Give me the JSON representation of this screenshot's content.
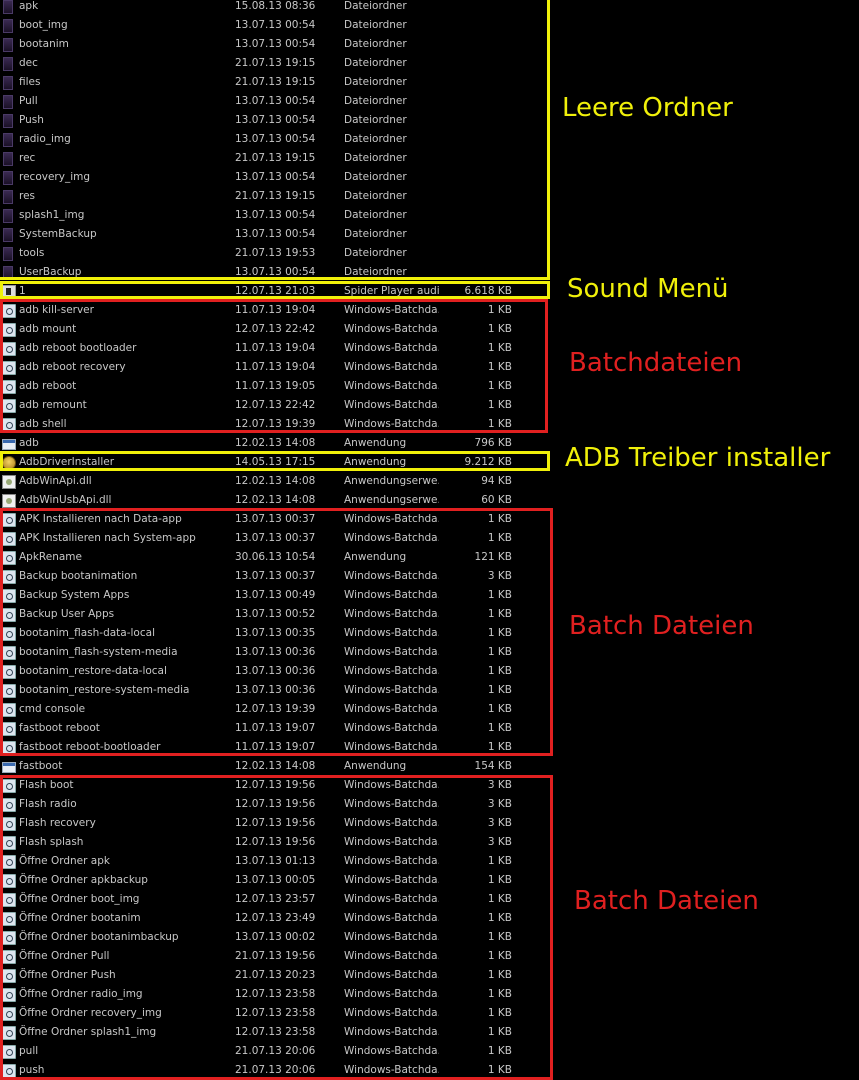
{
  "files": [
    {
      "name": "apk",
      "date": "15.08.13 08:36",
      "type": "Dateiordner",
      "size": "",
      "icon": "folder-icon"
    },
    {
      "name": "boot_img",
      "date": "13.07.13 00:54",
      "type": "Dateiordner",
      "size": "",
      "icon": "folder-icon"
    },
    {
      "name": "bootanim",
      "date": "13.07.13 00:54",
      "type": "Dateiordner",
      "size": "",
      "icon": "folder-icon"
    },
    {
      "name": "dec",
      "date": "21.07.13 19:15",
      "type": "Dateiordner",
      "size": "",
      "icon": "folder-icon"
    },
    {
      "name": "files",
      "date": "21.07.13 19:15",
      "type": "Dateiordner",
      "size": "",
      "icon": "folder-icon"
    },
    {
      "name": "Pull",
      "date": "13.07.13 00:54",
      "type": "Dateiordner",
      "size": "",
      "icon": "folder-icon"
    },
    {
      "name": "Push",
      "date": "13.07.13 00:54",
      "type": "Dateiordner",
      "size": "",
      "icon": "folder-icon"
    },
    {
      "name": "radio_img",
      "date": "13.07.13 00:54",
      "type": "Dateiordner",
      "size": "",
      "icon": "folder-icon"
    },
    {
      "name": "rec",
      "date": "21.07.13 19:15",
      "type": "Dateiordner",
      "size": "",
      "icon": "folder-icon"
    },
    {
      "name": "recovery_img",
      "date": "13.07.13 00:54",
      "type": "Dateiordner",
      "size": "",
      "icon": "folder-icon"
    },
    {
      "name": "res",
      "date": "21.07.13 19:15",
      "type": "Dateiordner",
      "size": "",
      "icon": "folder-icon"
    },
    {
      "name": "splash1_img",
      "date": "13.07.13 00:54",
      "type": "Dateiordner",
      "size": "",
      "icon": "folder-icon"
    },
    {
      "name": "SystemBackup",
      "date": "13.07.13 00:54",
      "type": "Dateiordner",
      "size": "",
      "icon": "folder-icon"
    },
    {
      "name": "tools",
      "date": "21.07.13 19:53",
      "type": "Dateiordner",
      "size": "",
      "icon": "folder-icon"
    },
    {
      "name": "UserBackup",
      "date": "13.07.13 00:54",
      "type": "Dateiordner",
      "size": "",
      "icon": "folder-icon"
    },
    {
      "name": "1",
      "date": "12.07.13 21:03",
      "type": "Spider Player audi...",
      "size": "6.618 KB",
      "icon": "audio-file-icon"
    },
    {
      "name": "adb kill-server",
      "date": "11.07.13 19:04",
      "type": "Windows-Batchda...",
      "size": "1 KB",
      "icon": "batch-file-icon"
    },
    {
      "name": "adb mount",
      "date": "12.07.13 22:42",
      "type": "Windows-Batchda...",
      "size": "1 KB",
      "icon": "batch-file-icon"
    },
    {
      "name": "adb reboot bootloader",
      "date": "11.07.13 19:04",
      "type": "Windows-Batchda...",
      "size": "1 KB",
      "icon": "batch-file-icon"
    },
    {
      "name": "adb reboot recovery",
      "date": "11.07.13 19:04",
      "type": "Windows-Batchda...",
      "size": "1 KB",
      "icon": "batch-file-icon"
    },
    {
      "name": "adb reboot",
      "date": "11.07.13 19:05",
      "type": "Windows-Batchda...",
      "size": "1 KB",
      "icon": "batch-file-icon"
    },
    {
      "name": "adb remount",
      "date": "12.07.13 22:42",
      "type": "Windows-Batchda...",
      "size": "1 KB",
      "icon": "batch-file-icon"
    },
    {
      "name": "adb shell",
      "date": "12.07.13 19:39",
      "type": "Windows-Batchda...",
      "size": "1 KB",
      "icon": "batch-file-icon"
    },
    {
      "name": "adb",
      "date": "12.02.13 14:08",
      "type": "Anwendung",
      "size": "796 KB",
      "icon": "application-icon"
    },
    {
      "name": "AdbDriverInstaller",
      "date": "14.05.13 17:15",
      "type": "Anwendung",
      "size": "9.212 KB",
      "icon": "installer-icon"
    },
    {
      "name": "AdbWinApi.dll",
      "date": "12.02.13 14:08",
      "type": "Anwendungserwe...",
      "size": "94 KB",
      "icon": "dll-file-icon"
    },
    {
      "name": "AdbWinUsbApi.dll",
      "date": "12.02.13 14:08",
      "type": "Anwendungserwe...",
      "size": "60 KB",
      "icon": "dll-file-icon"
    },
    {
      "name": "APK Installieren nach Data-app",
      "date": "13.07.13 00:37",
      "type": "Windows-Batchda...",
      "size": "1 KB",
      "icon": "batch-file-icon"
    },
    {
      "name": "APK Installieren nach System-app",
      "date": "13.07.13 00:37",
      "type": "Windows-Batchda...",
      "size": "1 KB",
      "icon": "batch-file-icon"
    },
    {
      "name": "ApkRename",
      "date": "30.06.13 10:54",
      "type": "Anwendung",
      "size": "121 KB",
      "icon": "batch-file-icon"
    },
    {
      "name": "Backup bootanimation",
      "date": "13.07.13 00:37",
      "type": "Windows-Batchda...",
      "size": "3 KB",
      "icon": "batch-file-icon"
    },
    {
      "name": "Backup System Apps",
      "date": "13.07.13 00:49",
      "type": "Windows-Batchda...",
      "size": "1 KB",
      "icon": "batch-file-icon"
    },
    {
      "name": "Backup User Apps",
      "date": "13.07.13 00:52",
      "type": "Windows-Batchda...",
      "size": "1 KB",
      "icon": "batch-file-icon"
    },
    {
      "name": "bootanim_flash-data-local",
      "date": "13.07.13 00:35",
      "type": "Windows-Batchda...",
      "size": "1 KB",
      "icon": "batch-file-icon"
    },
    {
      "name": "bootanim_flash-system-media",
      "date": "13.07.13 00:36",
      "type": "Windows-Batchda...",
      "size": "1 KB",
      "icon": "batch-file-icon"
    },
    {
      "name": "bootanim_restore-data-local",
      "date": "13.07.13 00:36",
      "type": "Windows-Batchda...",
      "size": "1 KB",
      "icon": "batch-file-icon"
    },
    {
      "name": "bootanim_restore-system-media",
      "date": "13.07.13 00:36",
      "type": "Windows-Batchda...",
      "size": "1 KB",
      "icon": "batch-file-icon"
    },
    {
      "name": "cmd console",
      "date": "12.07.13 19:39",
      "type": "Windows-Batchda...",
      "size": "1 KB",
      "icon": "batch-file-icon"
    },
    {
      "name": "fastboot reboot",
      "date": "11.07.13 19:07",
      "type": "Windows-Batchda...",
      "size": "1 KB",
      "icon": "batch-file-icon"
    },
    {
      "name": "fastboot reboot-bootloader",
      "date": "11.07.13 19:07",
      "type": "Windows-Batchda...",
      "size": "1 KB",
      "icon": "batch-file-icon"
    },
    {
      "name": "fastboot",
      "date": "12.02.13 14:08",
      "type": "Anwendung",
      "size": "154 KB",
      "icon": "application-icon"
    },
    {
      "name": "Flash boot",
      "date": "12.07.13 19:56",
      "type": "Windows-Batchda...",
      "size": "3 KB",
      "icon": "batch-file-icon"
    },
    {
      "name": "Flash radio",
      "date": "12.07.13 19:56",
      "type": "Windows-Batchda...",
      "size": "3 KB",
      "icon": "batch-file-icon"
    },
    {
      "name": "Flash recovery",
      "date": "12.07.13 19:56",
      "type": "Windows-Batchda...",
      "size": "3 KB",
      "icon": "batch-file-icon"
    },
    {
      "name": "Flash splash",
      "date": "12.07.13 19:56",
      "type": "Windows-Batchda...",
      "size": "3 KB",
      "icon": "batch-file-icon"
    },
    {
      "name": "Öffne Ordner apk",
      "date": "13.07.13 01:13",
      "type": "Windows-Batchda...",
      "size": "1 KB",
      "icon": "batch-file-icon"
    },
    {
      "name": "Öffne Ordner apkbackup",
      "date": "13.07.13 00:05",
      "type": "Windows-Batchda...",
      "size": "1 KB",
      "icon": "batch-file-icon"
    },
    {
      "name": "Öffne Ordner boot_img",
      "date": "12.07.13 23:57",
      "type": "Windows-Batchda...",
      "size": "1 KB",
      "icon": "batch-file-icon"
    },
    {
      "name": "Öffne Ordner bootanim",
      "date": "12.07.13 23:49",
      "type": "Windows-Batchda...",
      "size": "1 KB",
      "icon": "batch-file-icon"
    },
    {
      "name": "Öffne Ordner bootanimbackup",
      "date": "13.07.13 00:02",
      "type": "Windows-Batchda...",
      "size": "1 KB",
      "icon": "batch-file-icon"
    },
    {
      "name": "Öffne Ordner Pull",
      "date": "21.07.13 19:56",
      "type": "Windows-Batchda...",
      "size": "1 KB",
      "icon": "batch-file-icon"
    },
    {
      "name": "Öffne Ordner Push",
      "date": "21.07.13 20:23",
      "type": "Windows-Batchda...",
      "size": "1 KB",
      "icon": "batch-file-icon"
    },
    {
      "name": "Öffne Ordner radio_img",
      "date": "12.07.13 23:58",
      "type": "Windows-Batchda...",
      "size": "1 KB",
      "icon": "batch-file-icon"
    },
    {
      "name": "Öffne Ordner recovery_img",
      "date": "12.07.13 23:58",
      "type": "Windows-Batchda...",
      "size": "1 KB",
      "icon": "batch-file-icon"
    },
    {
      "name": "Öffne Ordner splash1_img",
      "date": "12.07.13 23:58",
      "type": "Windows-Batchda...",
      "size": "1 KB",
      "icon": "batch-file-icon"
    },
    {
      "name": "pull",
      "date": "21.07.13 20:06",
      "type": "Windows-Batchda...",
      "size": "1 KB",
      "icon": "batch-file-icon"
    },
    {
      "name": "push",
      "date": "21.07.13 20:06",
      "type": "Windows-Batchda...",
      "size": "1 KB",
      "icon": "batch-file-icon"
    }
  ],
  "annotations": {
    "empty_folders": "Leere Ordner",
    "sound_menu": "Sound Menü",
    "batch_files_1": "Batchdateien",
    "adb_driver": "ADB Treiber installer",
    "batch_files_2": "Batch Dateien",
    "batch_files_3": "Batch Dateien"
  },
  "colors": {
    "highlight_yellow": "#f0f00a",
    "highlight_red": "#e02020",
    "background": "#000000",
    "text": "#c8c8c8"
  }
}
